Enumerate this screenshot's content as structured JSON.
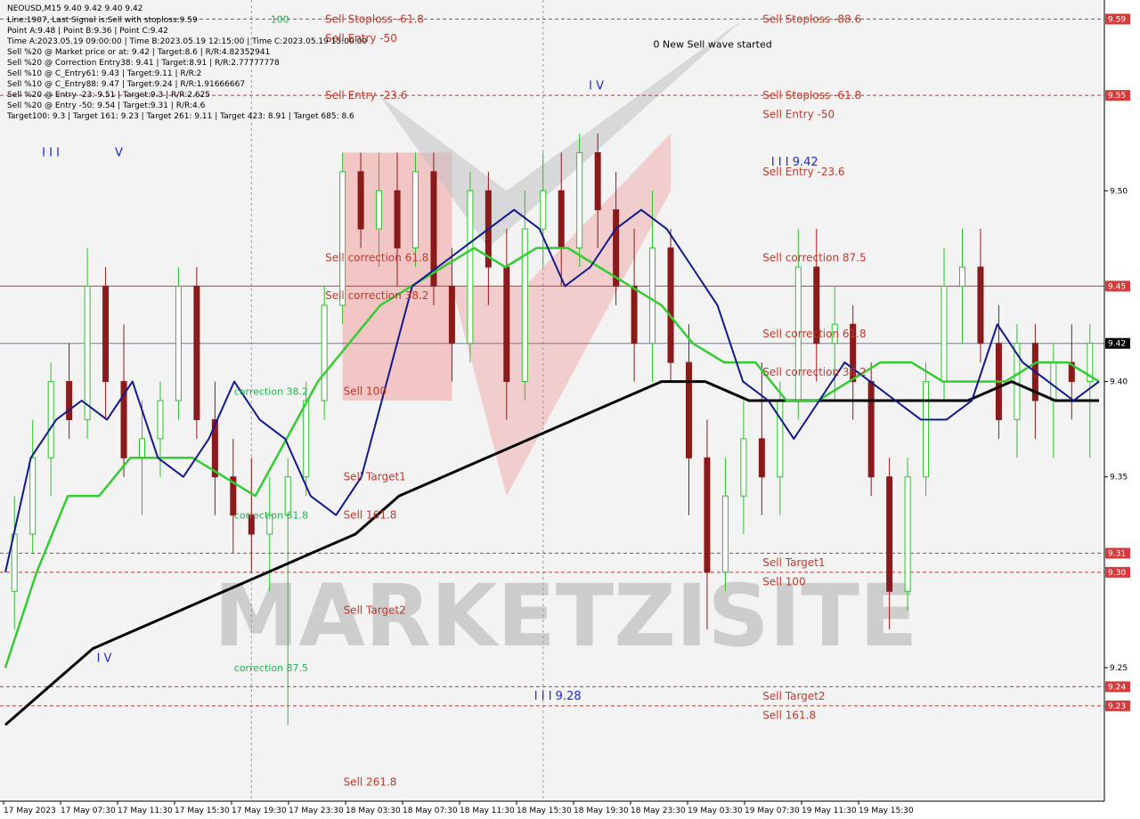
{
  "chart_data": {
    "type": "candlestick",
    "symbol_line": "NEOUSD,M15  9.40 9.42 9.40 9.42",
    "info_lines": [
      "Line:1907, Last Signal is:Sell with stoploss:9.59",
      "Point A:9.48  | Point B:9.36  | Point C:9.42",
      "Time A:2023.05.19 09:00:00  | Time B:2023.05.19 12:15:00  | Time C:2023.05.19 15:00:00",
      "Sell %20 @ Market price or at: 9.42  | Target:8.6  | R/R:4.82352941",
      "Sell %20 @ Correction Entry38: 9.41  | Target:8.91  | R/R:2.77777778",
      "Sell %10 @ C_Entry61: 9.43  | Target:9.11  | R/R:2",
      "Sell %10 @ C_Entry88: 9.47  | Target:9.24  | R/R:1.91666667",
      "Sell %20 @ Entry -23: 9.51  | Target:9.3  | R/R:2.625",
      "Sell %20 @ Entry -50: 9.54  | Target:9.31  | R/R:4.6",
      "Target100: 9.3  | Target 161: 9.23  | Target 261: 9.11  | Target 423: 8.91  | Target 685: 8.6"
    ],
    "y_ticks": [
      "9.50",
      "9.40",
      "9.35",
      "9.25"
    ],
    "y_tick_values": [
      9.5,
      9.4,
      9.35,
      9.25
    ],
    "x_labels": [
      "17 May 2023",
      "17 May 07:30",
      "17 May 11:30",
      "17 May 15:30",
      "17 May 19:30",
      "17 May 23:30",
      "18 May 03:30",
      "18 May 07:30",
      "18 May 11:30",
      "18 May 15:30",
      "18 May 19:30",
      "18 May 23:30",
      "19 May 03:30",
      "19 May 07:30",
      "19 May 11:30",
      "19 May 15:30"
    ],
    "ylim": [
      9.18,
      9.6
    ],
    "price_lines": [
      {
        "label": "9.59",
        "value": 9.59,
        "color": "#c0392b",
        "style": "dashed"
      },
      {
        "label": "9.55",
        "value": 9.55,
        "color": "#c0392b",
        "style": "dashed"
      },
      {
        "label": "9.45",
        "value": 9.45,
        "color": "#e03030",
        "style": "solid"
      },
      {
        "label": "9.42",
        "value": 9.42,
        "color": "#6a7fa8",
        "style": "solid"
      },
      {
        "label": "9.31",
        "value": 9.31,
        "color": "#c0392b",
        "style": "dashed"
      },
      {
        "label": "9.30",
        "value": 9.3,
        "color": "#c0392b",
        "style": "dashed"
      },
      {
        "label": "9.24",
        "value": 9.24,
        "color": "#c0392b",
        "style": "dashed"
      },
      {
        "label": "9.23",
        "value": 9.23,
        "color": "#c0392b",
        "style": "dashed"
      }
    ],
    "highlight_labels": {
      "9.59": "red",
      "9.55": "red",
      "9.45": "red",
      "9.42": "dark",
      "9.31": "red",
      "9.30": "red",
      "9.24": "red",
      "9.23": "red"
    },
    "ma_fast_values": [
      9.3,
      9.36,
      9.38,
      9.39,
      9.38,
      9.4,
      9.36,
      9.35,
      9.37,
      9.4,
      9.38,
      9.37,
      9.34,
      9.33,
      9.35,
      9.4,
      9.45,
      9.46,
      9.47,
      9.48,
      9.49,
      9.48,
      9.45,
      9.46,
      9.48,
      9.49,
      9.48,
      9.46,
      9.44,
      9.4,
      9.39,
      9.37,
      9.39,
      9.41,
      9.4,
      9.39,
      9.38,
      9.38,
      9.39,
      9.43,
      9.41,
      9.4,
      9.39,
      9.4
    ],
    "ma_mid_values": [
      9.25,
      9.3,
      9.34,
      9.34,
      9.36,
      9.36,
      9.36,
      9.35,
      9.34,
      9.37,
      9.4,
      9.42,
      9.44,
      9.45,
      9.46,
      9.47,
      9.46,
      9.47,
      9.47,
      9.46,
      9.45,
      9.44,
      9.42,
      9.41,
      9.41,
      9.39,
      9.39,
      9.4,
      9.41,
      9.41,
      9.4,
      9.4,
      9.4,
      9.41,
      9.41,
      9.4
    ],
    "ma_slow_values": [
      9.22,
      9.24,
      9.26,
      9.27,
      9.28,
      9.29,
      9.3,
      9.31,
      9.32,
      9.34,
      9.35,
      9.36,
      9.37,
      9.38,
      9.39,
      9.4,
      9.4,
      9.39,
      9.39,
      9.39,
      9.39,
      9.39,
      9.39,
      9.4,
      9.39,
      9.39
    ],
    "candles": [
      [
        9.29,
        9.34,
        9.27,
        9.32
      ],
      [
        9.32,
        9.38,
        9.31,
        9.36
      ],
      [
        9.36,
        9.41,
        9.34,
        9.4
      ],
      [
        9.4,
        9.42,
        9.37,
        9.38
      ],
      [
        9.38,
        9.47,
        9.37,
        9.45
      ],
      [
        9.45,
        9.46,
        9.38,
        9.4
      ],
      [
        9.4,
        9.43,
        9.35,
        9.36
      ],
      [
        9.36,
        9.39,
        9.33,
        9.37
      ],
      [
        9.37,
        9.4,
        9.35,
        9.39
      ],
      [
        9.39,
        9.46,
        9.38,
        9.45
      ],
      [
        9.45,
        9.46,
        9.37,
        9.38
      ],
      [
        9.38,
        9.4,
        9.33,
        9.35
      ],
      [
        9.35,
        9.37,
        9.31,
        9.33
      ],
      [
        9.33,
        9.36,
        9.3,
        9.32
      ],
      [
        9.32,
        9.35,
        9.29,
        9.33
      ],
      [
        9.33,
        9.36,
        9.22,
        9.35
      ],
      [
        9.35,
        9.4,
        9.34,
        9.39
      ],
      [
        9.39,
        9.45,
        9.38,
        9.44
      ],
      [
        9.44,
        9.52,
        9.43,
        9.51
      ],
      [
        9.51,
        9.52,
        9.47,
        9.48
      ],
      [
        9.48,
        9.52,
        9.46,
        9.5
      ],
      [
        9.5,
        9.52,
        9.45,
        9.47
      ],
      [
        9.47,
        9.52,
        9.46,
        9.51
      ],
      [
        9.51,
        9.52,
        9.44,
        9.45
      ],
      [
        9.45,
        9.47,
        9.4,
        9.42
      ],
      [
        9.42,
        9.51,
        9.41,
        9.5
      ],
      [
        9.5,
        9.51,
        9.44,
        9.46
      ],
      [
        9.46,
        9.48,
        9.38,
        9.4
      ],
      [
        9.4,
        9.5,
        9.39,
        9.48
      ],
      [
        9.48,
        9.52,
        9.46,
        9.5
      ],
      [
        9.5,
        9.52,
        9.45,
        9.47
      ],
      [
        9.47,
        9.53,
        9.46,
        9.52
      ],
      [
        9.52,
        9.53,
        9.47,
        9.49
      ],
      [
        9.49,
        9.51,
        9.44,
        9.45
      ],
      [
        9.45,
        9.48,
        9.4,
        9.42
      ],
      [
        9.42,
        9.5,
        9.4,
        9.47
      ],
      [
        9.47,
        9.48,
        9.4,
        9.41
      ],
      [
        9.41,
        9.43,
        9.33,
        9.36
      ],
      [
        9.36,
        9.38,
        9.27,
        9.3
      ],
      [
        9.3,
        9.36,
        9.29,
        9.34
      ],
      [
        9.34,
        9.39,
        9.32,
        9.37
      ],
      [
        9.37,
        9.41,
        9.33,
        9.35
      ],
      [
        9.35,
        9.4,
        9.33,
        9.39
      ],
      [
        9.39,
        9.48,
        9.38,
        9.46
      ],
      [
        9.46,
        9.48,
        9.4,
        9.42
      ],
      [
        9.42,
        9.45,
        9.39,
        9.43
      ],
      [
        9.43,
        9.44,
        9.38,
        9.4
      ],
      [
        9.4,
        9.41,
        9.34,
        9.35
      ],
      [
        9.35,
        9.36,
        9.27,
        9.29
      ],
      [
        9.29,
        9.36,
        9.28,
        9.35
      ],
      [
        9.35,
        9.41,
        9.34,
        9.4
      ],
      [
        9.4,
        9.47,
        9.39,
        9.45
      ],
      [
        9.45,
        9.48,
        9.42,
        9.46
      ],
      [
        9.46,
        9.48,
        9.41,
        9.42
      ],
      [
        9.42,
        9.44,
        9.37,
        9.38
      ],
      [
        9.38,
        9.43,
        9.36,
        9.42
      ],
      [
        9.42,
        9.43,
        9.37,
        9.39
      ],
      [
        9.39,
        9.42,
        9.36,
        9.41
      ],
      [
        9.41,
        9.43,
        9.38,
        9.4
      ],
      [
        9.4,
        9.43,
        9.36,
        9.42
      ]
    ],
    "chart_labels": [
      {
        "text": "Sell Stoploss -61.8",
        "kind": "red",
        "price": 9.59,
        "bar": 19
      },
      {
        "text": "Sell Entry -50",
        "kind": "red",
        "price": 9.58,
        "bar": 19
      },
      {
        "text": "100",
        "kind": "green",
        "price": 9.59,
        "bar": 16
      },
      {
        "text": "Sell Entry -23.6",
        "kind": "red",
        "price": 9.55,
        "bar": 19
      },
      {
        "text": "Sell correction 61.8",
        "kind": "red",
        "price": 9.465,
        "bar": 19
      },
      {
        "text": "Sell correction 38.2",
        "kind": "red",
        "price": 9.445,
        "bar": 19
      },
      {
        "text": "Sell 100",
        "kind": "red",
        "price": 9.395,
        "bar": 20
      },
      {
        "text": "correction 38.2",
        "kind": "green",
        "price": 9.395,
        "bar": 14
      },
      {
        "text": "Sell Target1",
        "kind": "red",
        "price": 9.35,
        "bar": 20
      },
      {
        "text": "correction 61.8",
        "kind": "green",
        "price": 9.33,
        "bar": 14
      },
      {
        "text": "Sell 161.8",
        "kind": "red",
        "price": 9.33,
        "bar": 20
      },
      {
        "text": "Sell Target2",
        "kind": "red",
        "price": 9.28,
        "bar": 20
      },
      {
        "text": "correction 87.5",
        "kind": "green",
        "price": 9.25,
        "bar": 14
      },
      {
        "text": "Sell  261.8",
        "kind": "red",
        "price": 9.19,
        "bar": 20
      },
      {
        "text": "0 New Sell wave started",
        "kind": "dark",
        "price": 9.577,
        "bar": 37
      },
      {
        "text": "Sell Stoploss -88.6",
        "kind": "red",
        "price": 9.59,
        "bar": 43
      },
      {
        "text": "Sell Stoploss -61.8",
        "kind": "red",
        "price": 9.55,
        "bar": 43
      },
      {
        "text": "Sell Entry -50",
        "kind": "red",
        "price": 9.54,
        "bar": 43
      },
      {
        "text": "Sell Entry -23.6",
        "kind": "red",
        "price": 9.51,
        "bar": 43
      },
      {
        "text": "Sell correction 87.5",
        "kind": "red",
        "price": 9.465,
        "bar": 43
      },
      {
        "text": "Sell correction 61.8",
        "kind": "red",
        "price": 9.425,
        "bar": 43
      },
      {
        "text": "Sell correction 38.2",
        "kind": "red",
        "price": 9.405,
        "bar": 43
      },
      {
        "text": "Sell Target1",
        "kind": "red",
        "price": 9.305,
        "bar": 43
      },
      {
        "text": "Sell 100",
        "kind": "red",
        "price": 9.295,
        "bar": 43
      },
      {
        "text": "Sell Target2",
        "kind": "red",
        "price": 9.235,
        "bar": 43
      },
      {
        "text": "Sell 161.8",
        "kind": "red",
        "price": 9.225,
        "bar": 43
      }
    ],
    "wave_labels": [
      {
        "text": "I I I",
        "price": 9.52,
        "bar": 2
      },
      {
        "text": "V",
        "price": 9.52,
        "bar": 6
      },
      {
        "text": "I V",
        "price": 9.555,
        "bar": 32
      },
      {
        "text": "I I I 9.42",
        "price": 9.515,
        "bar": 42
      },
      {
        "text": "I V",
        "price": 9.255,
        "bar": 5
      },
      {
        "text": "I I I 9.28",
        "price": 9.235,
        "bar": 29
      }
    ],
    "watermark": "MARKETZISITE",
    "grid": true
  }
}
